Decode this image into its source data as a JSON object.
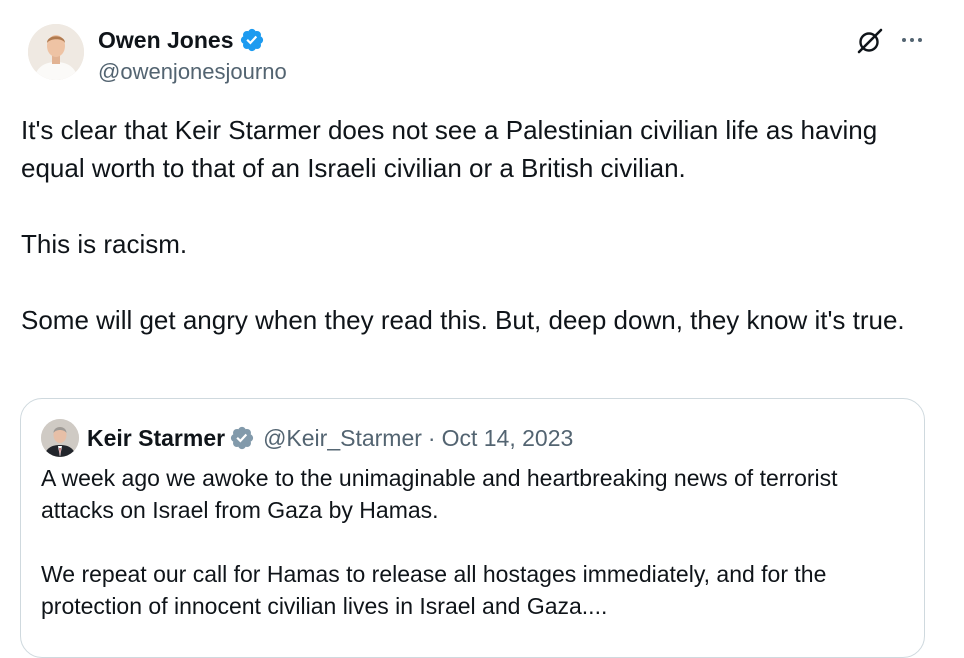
{
  "author": {
    "display_name": "Owen Jones",
    "handle": "@owenjonesjourno",
    "verified": true,
    "verified_color": "#1d9bf0"
  },
  "tweet": {
    "paragraphs": [
      "It's clear that Keir Starmer does not see a Palestinian civilian life as having equal worth to that of an Israeli civilian or a British civilian.",
      "This is racism.",
      "Some will get angry when they read this. But, deep down, they know it's true."
    ]
  },
  "actions": {
    "grok_icon": "grok-icon",
    "more_icon": "more-icon"
  },
  "quoted_tweet": {
    "display_name": "Keir Starmer",
    "verified_badge": "gray",
    "verified_color": "#829aab",
    "handle": "@Keir_Starmer",
    "separator": "·",
    "date": "Oct 14, 2023",
    "paragraphs": [
      "A week ago we awoke to the unimaginable and heartbreaking news of terrorist attacks on Israel from Gaza by Hamas.",
      "We repeat our call for Hamas to release all hostages immediately, and for the protection of innocent civilian lives in Israel and Gaza...."
    ]
  },
  "colors": {
    "text_primary": "#0f1419",
    "text_secondary": "#536471",
    "card_border": "#cfd9de"
  }
}
